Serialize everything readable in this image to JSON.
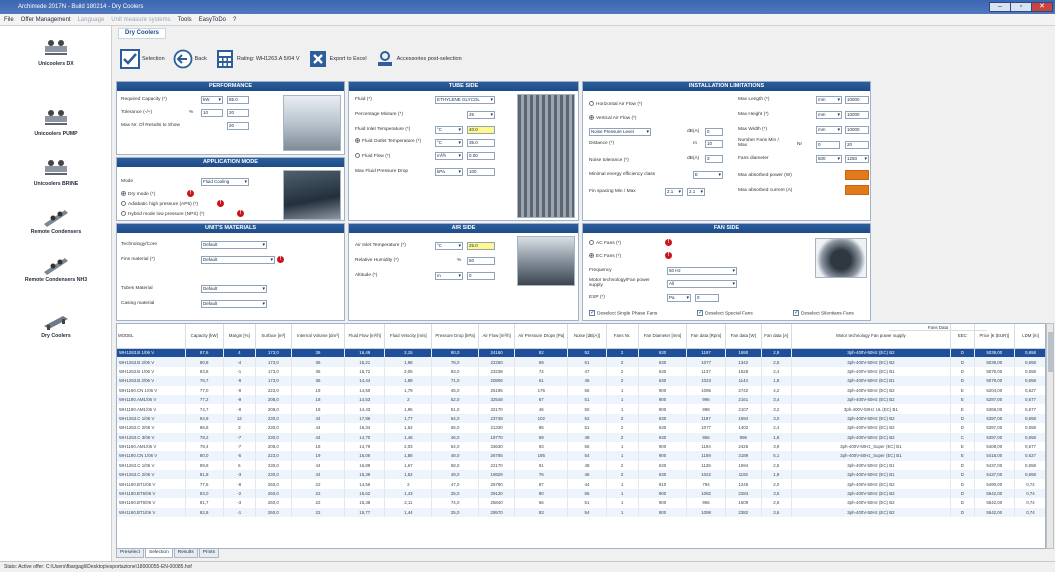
{
  "window": {
    "title": "Archimede 2017N - Build 180214 - Dry Coolers",
    "min": "–",
    "max": "▫",
    "close": "✕"
  },
  "menu": [
    "File",
    "Offer Management",
    "Language",
    "Unit measure systems",
    "Tools",
    "EasyToDo",
    "?"
  ],
  "sidebar": [
    {
      "label": "Unicoolers DX",
      "icon": "unicooler-dx-icon"
    },
    {
      "label": "Unicoolers PUMP",
      "icon": "unicooler-pump-icon"
    },
    {
      "label": "Unicoolers BRINE",
      "icon": "unicooler-brine-icon"
    },
    {
      "label": "Remote Condensers",
      "icon": "remote-condenser-icon"
    },
    {
      "label": "Remote Condensers NH3",
      "icon": "remote-condenser-nh3-icon"
    },
    {
      "label": "Dry Coolers",
      "icon": "dry-cooler-icon"
    }
  ],
  "doc_tab": "Dry Coolers",
  "toolbar": {
    "selection": "Selection",
    "back": "Back",
    "rating": "Rating: WH1263.A 5/04 V",
    "export": "Export to Excel",
    "accessories": "Accessories post-selection"
  },
  "performance": {
    "title": "PERFORMANCE",
    "required_capacity": "Required Capacity (*)",
    "cap_unit": "kW",
    "cap_value": "85.0",
    "tolerance": "Tolerance (-/+)",
    "tol_unit": "%",
    "tol_min": "10",
    "tol_max": "20",
    "max_results": "Max Nr. Of Results to Show",
    "max_results_value": "20"
  },
  "application": {
    "title": "APPLICATION MODE",
    "mode": "Mode",
    "mode_value": "Fluid Cooling",
    "dry": "Dry mode (*)",
    "adiabatic": "Adiabatic high pressure (AP5) (*)",
    "hybrid": "Hybrid mode low pressure (NPS) (*)"
  },
  "materials": {
    "title": "UNIT'S MATERIALS",
    "tech": "Technology/Core",
    "tech_value": "Default",
    "fins": "Fins material (*)",
    "fins_value": "Default",
    "tubes": "Tubes Material",
    "tubes_value": "Default",
    "casing": "Casing material",
    "casing_value": "Default"
  },
  "tube": {
    "title": "TUBE SIDE",
    "fluid": "Fluid (*)",
    "fluid_value": "ETHYLENE GLYCOL",
    "mixture": "Percentage Mixture (*)",
    "mixture_value": "25",
    "inlet": "Fluid Inlet Temperature (*)",
    "inlet_unit": "°C",
    "inlet_value": "40.0",
    "outlet": "Fluid Outlet Temperature (*)",
    "outlet_unit": "°C",
    "outlet_value": "35.0",
    "flow": "Fluid Flow (*)",
    "flow_unit": "m³/h",
    "flow_value": "0.00",
    "pdrop": "Max Fluid Pressure Drop",
    "pdrop_unit": "kPa",
    "pdrop_value": "100"
  },
  "air": {
    "title": "AIR SIDE",
    "inlet": "Air Inlet Temperature (*)",
    "inlet_unit": "°C",
    "inlet_value": "25.0",
    "rh": "Relative Humidity (*)",
    "rh_unit": "%",
    "rh_value": "50",
    "alt": "Altitude (*)",
    "alt_unit": "m",
    "alt_value": "0"
  },
  "install": {
    "title": "INSTALLATION LIMITATIONS",
    "hor": "Horizontal Air Flow (*)",
    "ver": "Vertical Air Flow (*)",
    "noise_sel": "Noise Pressure Level",
    "noise_unit": "dB(A)",
    "noise_value": "0",
    "distance": "Distance (*)",
    "dist_unit": "m",
    "dist_value": "10",
    "noise_tol": "Noise tolerance (*)",
    "noise_tol_unit": "dB(A)",
    "noise_tol_value": "3",
    "min_eff": "Minimal energy efficiency class",
    "min_eff_value": "E",
    "fin_spacing": "Fin spacing Min / Max",
    "fin_min": "2.1",
    "fin_max": "2.1",
    "max_len": "Max Length (*)",
    "len_unit": "mm",
    "len_value": "10000",
    "max_h": "Max Height (*)",
    "h_unit": "mm",
    "h_value": "10000",
    "max_w": "Max Width (*)",
    "w_unit": "mm",
    "w_value": "10000",
    "fans_nr": "Number Fans Min / Max",
    "fans_unit": "Nr",
    "fans_min": "0",
    "fans_max": "20",
    "fan_d": "Fans diameter",
    "fan_d_min": "500",
    "fan_d_max": "1250",
    "abs_pow": "Max absorbed power (W)",
    "abs_cur": "Max absorbed current (A)"
  },
  "fan": {
    "title": "FAN SIDE",
    "ac": "AC Fans (*)",
    "ec": "EC Fans (*)",
    "freq": "Frequency",
    "freq_value": "50 Hz",
    "motor": "Motor technology/Fan power supply",
    "motor_value": "All",
    "esp": "ESP (*)",
    "esp_unit": "Pa",
    "esp_value": "0",
    "c1": "Deselect Single Phase Fans",
    "c2": "Deselect Special Fans",
    "c3": "Deselect Silentians Fans"
  },
  "grid": {
    "headers": [
      "MODEL",
      "Capacity [kW]",
      "Margin [%]",
      "Surface [m²]",
      "Internal Volume [dm³]",
      "Fluid Flow [m³/h]",
      "Fluid Velocity [m/s]",
      "Pressure Drop [kPa]",
      "Air Flow [m³/h]",
      "Air Pressure Drops [Pa]",
      "Noise [dB(A)]",
      "Fans Nr.",
      "Fan Diameter [mm]",
      "Fan data [Rpm]",
      "Fan data [W]",
      "Fan data [A]",
      "Motor technology Fan power supply",
      "EEC",
      "Price [€ (EUR)]",
      "LDM [m]"
    ],
    "fan_data_group": "Fans Data",
    "rows": [
      [
        "WH1263.B 1/06 V",
        "87,6",
        "4",
        "173,0",
        "36",
        "16,49",
        "2,15",
        "90,0",
        "24160",
        "82",
        "52",
        "2",
        "630",
        "1197",
        "1690",
        "2,9",
        "3ph-400V-50Hz (EC) B2",
        "D",
        "5039,00",
        "0,658"
      ],
      [
        "WH1263.B 2/06 V",
        "80,8",
        "-4",
        "173,0",
        "36",
        "15,21",
        "1,98",
        "78,0",
        "22250",
        "69",
        "51",
        "2",
        "630",
        "1077",
        "1342",
        "2,5",
        "3ph-400V-50Hz (EC) B2",
        "D",
        "5039,00",
        "0,658"
      ],
      [
        "WH1263.B 1/06 V",
        "83,8",
        "-1",
        "173,0",
        "36",
        "15,72",
        "2,05",
        "83,0",
        "23238",
        "74",
        "47",
        "2",
        "630",
        "1137",
        "1528",
        "2,4",
        "3ph-400V-50Hz (EC) B1",
        "D",
        "5079,00",
        "0,658"
      ],
      [
        "WH1263.B 2/06 V",
        "76,7",
        "-9",
        "173,0",
        "36",
        "14,44",
        "1,88",
        "71,0",
        "20806",
        "61",
        "46",
        "2",
        "630",
        "1023",
        "1144",
        "1,8",
        "3ph-400V-50Hz (EC) B1",
        "D",
        "5079,00",
        "0,658"
      ],
      [
        "WH1190.CN 1/06 V",
        "77,0",
        "-9",
        "223,0",
        "19",
        "14,50",
        "1,79",
        "45,0",
        "25195",
        "176",
        "56",
        "1",
        "900",
        "1095",
        "2742",
        "4,2",
        "3ph-400V-50Hz (EC) B2",
        "E",
        "5204,00",
        "0,627"
      ],
      [
        "WH1190.AM1/06 V",
        "77,2",
        "-9",
        "208,0",
        "18",
        "14,53",
        "2",
        "52,0",
        "32548",
        "67",
        "51",
        "1",
        "900",
        "996",
        "2161",
        "3,4",
        "3ph-400V-50Hz (EC) B2",
        "E",
        "5287,00",
        "0,677"
      ],
      [
        "WH1190.AM1/06 V",
        "74,7",
        "-9",
        "208,0",
        "18",
        "14,43",
        "1,95",
        "51,0",
        "32170",
        "46",
        "50",
        "1",
        "900",
        "998",
        "2107",
        "3,2",
        "3ph-400V-50Hz UL (EC) B1",
        "E",
        "5368,00",
        "0,677"
      ],
      [
        "WH1263.C 1/06 V",
        "94,9",
        "12",
        "230,0",
        "44",
        "17,86",
        "1,77",
        "64,0",
        "23748",
        "102",
        "52",
        "2",
        "630",
        "1197",
        "1694",
        "3,0",
        "3ph-400V-50Hz (EC) B2",
        "D",
        "5397,00",
        "0,658"
      ],
      [
        "WH1263.C 2/06 V",
        "86,8",
        "3",
        "230,0",
        "44",
        "16,34",
        "1,62",
        "55,0",
        "21330",
        "85",
        "51",
        "2",
        "630",
        "1077",
        "1402",
        "2,4",
        "3ph-400V-50Hz (EC) B2",
        "D",
        "5397,00",
        "0,658"
      ],
      [
        "WH1263.C 3/06 V",
        "78,2",
        "-7",
        "230,0",
        "44",
        "14,70",
        "1,46",
        "46,0",
        "18770",
        "69",
        "49",
        "2",
        "630",
        "956",
        "996",
        "1,8",
        "3ph-400V-50Hz (EC) B2",
        "C",
        "5397,00",
        "0,658"
      ],
      [
        "WH1190.AM1/06 V",
        "78,4",
        "-7",
        "208,0",
        "18",
        "14,79",
        "2,03",
        "54,0",
        "33630",
        "93",
        "56",
        "1",
        "900",
        "1194",
        "2426",
        "3,9",
        "3ph-400V-50Hz_Super (EC) B1",
        "E",
        "5408,00",
        "0,677"
      ],
      [
        "WH1190.CN 1/06 V",
        "80,0",
        "-5",
        "223,0",
        "19",
        "15,06",
        "1,86",
        "48,0",
        "26765",
        "195",
        "54",
        "1",
        "900",
        "1169",
        "3189",
        "5,1",
        "3ph-400V-50Hz_Super (EC) B1",
        "E",
        "5418,00",
        "0,627"
      ],
      [
        "WH1263.C 1/06 V",
        "89,8",
        "6",
        "230,0",
        "44",
        "16,89",
        "1,67",
        "58,0",
        "22170",
        "91",
        "48",
        "2",
        "630",
        "1136",
        "1594",
        "2,5",
        "3ph-400V-50Hz (EC) B1",
        "D",
        "5437,00",
        "0,658"
      ],
      [
        "WH1263.C 2/06 V",
        "81,8",
        "-3",
        "230,0",
        "44",
        "15,39",
        "1,52",
        "49,0",
        "19829",
        "76",
        "46",
        "2",
        "630",
        "1022",
        "1192",
        "1,9",
        "3ph-400V-50Hz (EC) B1",
        "D",
        "5437,00",
        "0,658"
      ],
      [
        "WH1190.BT1/06 V",
        "77,5",
        "-8",
        "260,0",
        "22",
        "14,56",
        "2",
        "47,0",
        "25790",
        "87",
        "44",
        "1",
        "910",
        "794",
        "1246",
        "2,0",
        "3ph-400V-50Hz (EC) B2",
        "D",
        "5490,00",
        "0,74"
      ],
      [
        "WH1190.BT5/06 V",
        "83,0",
        "-2",
        "260,0",
        "22",
        "15,62",
        "1,43",
        "25,0",
        "29120",
        "80",
        "55",
        "1",
        "900",
        "1082",
        "2284",
        "3,5",
        "3ph-400V-50Hz (EC) B2",
        "D",
        "5542,00",
        "0,74"
      ],
      [
        "WH1190.BT6/06 V",
        "81,7",
        "-3",
        "260,0",
        "22",
        "15,38",
        "2,11",
        "74,0",
        "25840",
        "66",
        "51",
        "1",
        "900",
        "965",
        "1609",
        "2,5",
        "3ph-400V-50Hz (EC) B2",
        "D",
        "5542,00",
        "0,74"
      ],
      [
        "WH1190.BT1/06 V",
        "82,8",
        "-1",
        "260,0",
        "22",
        "15,77",
        "1,44",
        "25,0",
        "29570",
        "83",
        "54",
        "1",
        "900",
        "1098",
        "2382",
        "3,6",
        "3ph-400V-50Hz (EC) B2",
        "D",
        "5542,00",
        "0,74"
      ]
    ]
  },
  "bottom_tabs": [
    "Preselect",
    "Selection",
    "Results",
    "Prints"
  ],
  "status": "Stato: Active offer: C:\\Users\\fbargagli\\Desktop\\esportazione\\18000055-EN-00085.hof"
}
